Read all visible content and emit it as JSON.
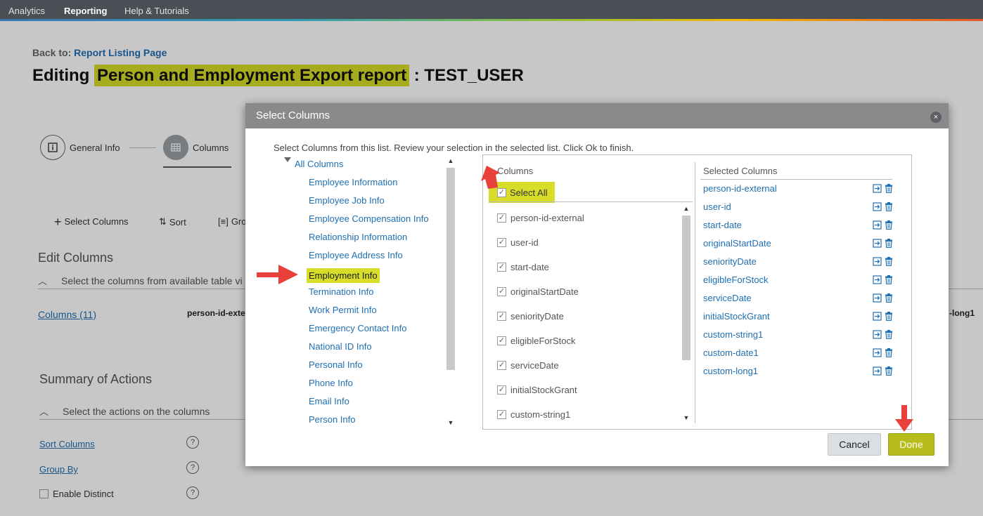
{
  "topnav": [
    "Analytics",
    "Reporting",
    "Help & Tutorials"
  ],
  "page": {
    "back_prefix": "Back to:",
    "back_link": "Report Listing Page",
    "title_prefix": "Editing",
    "title_highlight": "Person and Employment Export report",
    "title_suffix": ": TEST_USER",
    "steps": [
      "General Info",
      "Columns"
    ],
    "toolbar": {
      "select_columns": "Select Columns",
      "sort": "Sort",
      "group": "Gro"
    },
    "edit_columns_title": "Edit Columns",
    "edit_columns_sub": "Select the columns from available table vi",
    "columns_link": "Columns (11)",
    "columns_preview_first": "person-id-exte",
    "columns_preview_last": "-long1",
    "summary_title": "Summary of Actions",
    "summary_sub": "Select the actions on the columns",
    "sort_columns": "Sort Columns",
    "group_by": "Group By",
    "enable_distinct": "Enable Distinct",
    "help_glyph": "?"
  },
  "modal": {
    "title": "Select Columns",
    "close_glyph": "×",
    "instruction": "Select Columns from this list. Review your selection in the selected list. Click Ok to finish.",
    "tree_root": "All Columns",
    "tree_items": [
      "Employee Information",
      "Employee Job Info",
      "Employee Compensation Info",
      "Relationship Information",
      "Employee Address Info",
      "Employment Info",
      "Termination Info",
      "Work Permit Info",
      "Emergency Contact Info",
      "National ID Info",
      "Personal Info",
      "Phone Info",
      "Email Info",
      "Person Info"
    ],
    "selected_tree_item": "Employment Info",
    "columns_header": "Columns",
    "select_all": "Select All",
    "column_items": [
      "person-id-external",
      "user-id",
      "start-date",
      "originalStartDate",
      "seniorityDate",
      "eligibleForStock",
      "serviceDate",
      "initialStockGrant",
      "custom-string1"
    ],
    "selected_header": "Selected Columns",
    "selected_items": [
      "person-id-external",
      "user-id",
      "start-date",
      "originalStartDate",
      "seniorityDate",
      "eligibleForStock",
      "serviceDate",
      "initialStockGrant",
      "custom-string1",
      "custom-date1",
      "custom-long1"
    ],
    "cancel_label": "Cancel",
    "done_label": "Done"
  },
  "colors": {
    "highlight": "#d7dd28",
    "link": "#1f6fb2",
    "annotation_arrow": "#e8403a",
    "done_button": "#b8bd1e"
  }
}
